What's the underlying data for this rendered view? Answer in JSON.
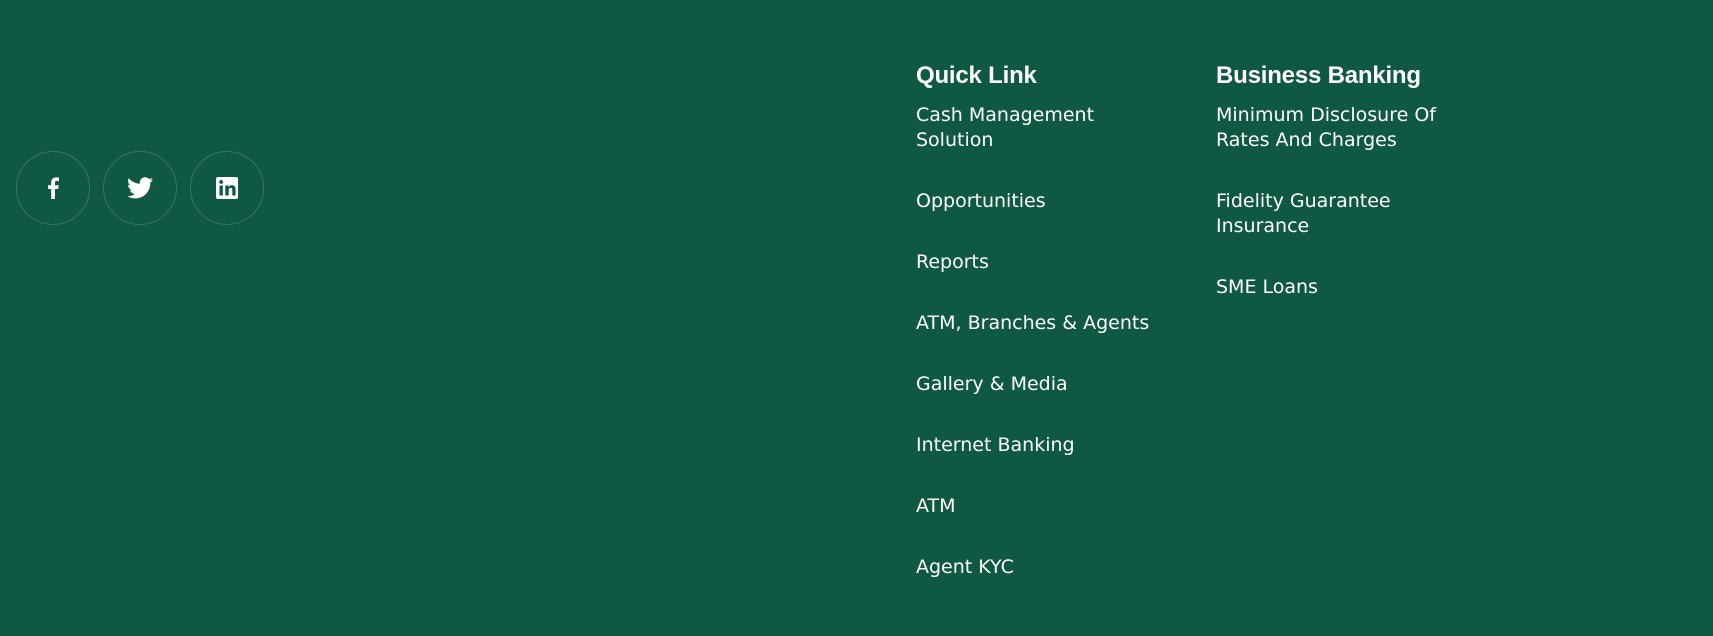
{
  "social": {
    "items": [
      {
        "icon": "facebook-icon"
      },
      {
        "icon": "twitter-icon"
      },
      {
        "icon": "linkedin-icon"
      }
    ]
  },
  "quick_link": {
    "title": "Quick Link",
    "items": [
      {
        "label": "Cash Management Solution"
      },
      {
        "label": "Opportunities"
      },
      {
        "label": "Reports"
      },
      {
        "label": "ATM, Branches & Agents"
      },
      {
        "label": "Gallery & Media"
      },
      {
        "label": "Internet Banking"
      },
      {
        "label": "ATM"
      },
      {
        "label": "Agent KYC"
      }
    ]
  },
  "business_banking": {
    "title": "Business Banking",
    "items": [
      {
        "label": "Minimum Disclosure Of Rates And Charges"
      },
      {
        "label": "Fidelity Guarantee Insurance"
      },
      {
        "label": "SME Loans"
      }
    ]
  },
  "colors": {
    "background": "#0f5843",
    "text": "#ffffff"
  }
}
